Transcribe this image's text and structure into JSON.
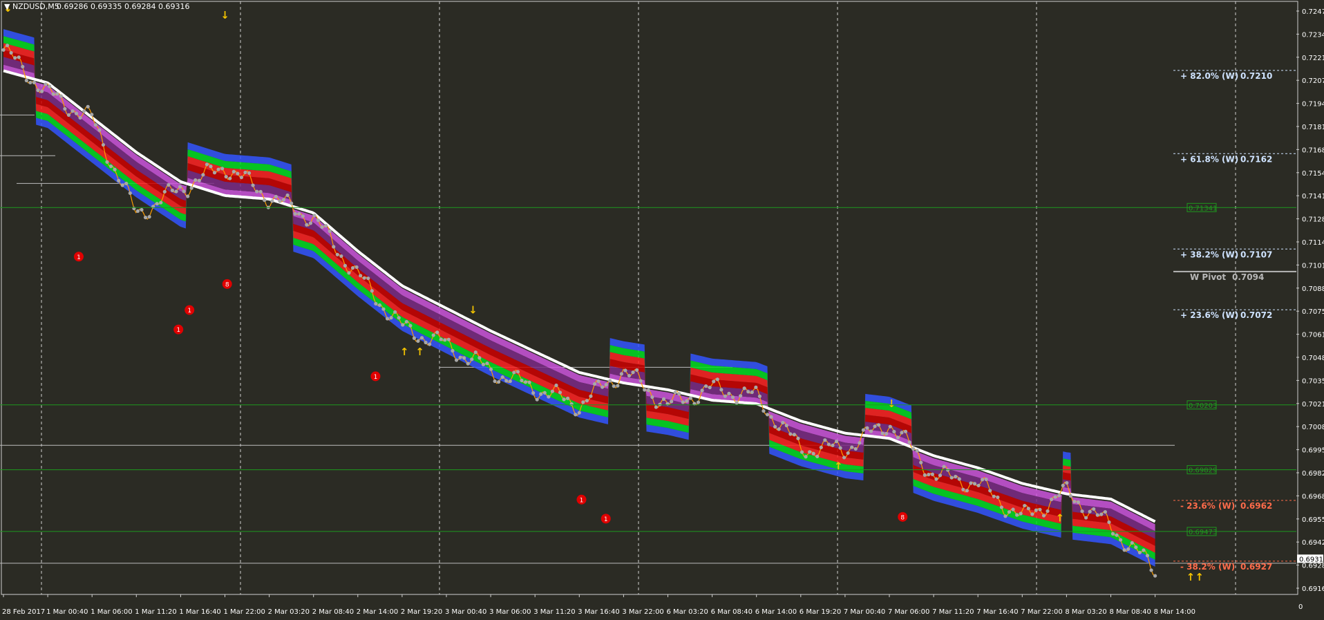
{
  "header": {
    "symbol": "NZDUSD,M5",
    "quote": "0.69286 0.69335 0.69284 0.69316",
    "menu_icon": "triangle-down-icon"
  },
  "colors": {
    "background": "#2b2b24",
    "grid": "#d0d0d0",
    "price_dots": "#a8a8a8",
    "fib_up": "#cfe3ff",
    "fib_down": "#ff6b4a",
    "pivot": "#b8b8b8",
    "green_levels": "#1e9a1e",
    "signal_dots": "#e00000",
    "arrows": "#f2c200"
  },
  "price_axis": {
    "labels": [
      "0.72475",
      "0.72345",
      "0.72210",
      "0.72075",
      "0.71945",
      "0.71810",
      "0.71680",
      "0.71545",
      "0.71410",
      "0.71280",
      "0.71145",
      "0.71015",
      "0.70880",
      "0.70750",
      "0.70615",
      "0.70480",
      "0.70350",
      "0.70215",
      "0.70085",
      "0.69950",
      "0.69820",
      "0.69685",
      "0.69550",
      "0.69420",
      "0.69285",
      "0.69160"
    ],
    "current_price": "0.69316"
  },
  "time_axis": {
    "labels": [
      "28 Feb 2017",
      "1 Mar 00:40",
      "1 Mar 06:00",
      "1 Mar 11:20",
      "1 Mar 16:40",
      "1 Mar 22:00",
      "2 Mar 03:20",
      "2 Mar 08:40",
      "2 Mar 14:00",
      "2 Mar 19:20",
      "3 Mar 00:40",
      "3 Mar 06:00",
      "3 Mar 11:20",
      "3 Mar 16:40",
      "3 Mar 22:00",
      "6 Mar 03:20",
      "6 Mar 08:40",
      "6 Mar 14:00",
      "6 Mar 19:20",
      "7 Mar 00:40",
      "7 Mar 06:00",
      "7 Mar 11:20",
      "7 Mar 16:40",
      "7 Mar 22:00",
      "8 Mar 03:20",
      "8 Mar 08:40",
      "8 Mar 14:00"
    ]
  },
  "fib_levels": [
    {
      "label": "+ 82.0% (W)",
      "value": "0.7210",
      "price": 0.721,
      "dir": "up"
    },
    {
      "label": "+ 61.8% (W)",
      "value": "0.7162",
      "price": 0.7162,
      "dir": "up"
    },
    {
      "label": "+ 38.2% (W)",
      "value": "0.7107",
      "price": 0.7107,
      "dir": "up"
    },
    {
      "label": "+ 23.6% (W)",
      "value": "0.7072",
      "price": 0.7072,
      "dir": "up"
    },
    {
      "label": "- 23.6% (W)",
      "value": "0.6962",
      "price": 0.6962,
      "dir": "down"
    },
    {
      "label": "- 38.2% (W)",
      "value": "0.6927",
      "price": 0.6927,
      "dir": "down"
    }
  ],
  "pivot": {
    "label": "W Pivot",
    "value": "0.7094",
    "price": 0.7094
  },
  "green_levels": [
    {
      "label": "0.71341",
      "price": 0.71341
    },
    {
      "label": "0.70203",
      "price": 0.70203
    },
    {
      "label": "0.69829",
      "price": 0.69829
    },
    {
      "label": "0.69473",
      "price": 0.69473
    }
  ],
  "chart_data": {
    "type": "line",
    "title": "NZDUSD,M5",
    "subtitle": "0.69286 0.69335 0.69284 0.69316",
    "xlabel": "",
    "ylabel": "",
    "ylim": [
      0.6911,
      0.7253
    ],
    "x": [
      "28 Feb 2017",
      "1 Mar 00:40",
      "1 Mar 06:00",
      "1 Mar 11:20",
      "1 Mar 16:40",
      "1 Mar 22:00",
      "2 Mar 03:20",
      "2 Mar 08:40",
      "2 Mar 14:00",
      "2 Mar 19:20",
      "3 Mar 00:40",
      "3 Mar 06:00",
      "3 Mar 11:20",
      "3 Mar 16:40",
      "3 Mar 22:00",
      "6 Mar 03:20",
      "6 Mar 08:40",
      "6 Mar 14:00",
      "6 Mar 19:20",
      "7 Mar 00:40",
      "7 Mar 06:00",
      "7 Mar 11:20",
      "7 Mar 16:40",
      "7 Mar 22:00",
      "8 Mar 03:20",
      "8 Mar 08:40",
      "8 Mar 14:00"
    ],
    "series": [
      {
        "values": [
          0.7225,
          0.72,
          0.7185,
          0.713,
          0.7145,
          0.7158,
          0.714,
          0.7128,
          0.7095,
          0.7065,
          0.7055,
          0.704,
          0.703,
          0.702,
          0.704,
          0.702,
          0.703,
          0.7025,
          0.6995,
          0.6995,
          0.701,
          0.698,
          0.6975,
          0.6955,
          0.697,
          0.695,
          0.6925
        ]
      },
      {
        "values": [
          0.7212,
          0.7205,
          0.7185,
          0.7165,
          0.7148,
          0.714,
          0.7138,
          0.713,
          0.7108,
          0.7088,
          0.7075,
          0.7062,
          0.705,
          0.7038,
          0.7032,
          0.7028,
          0.7022,
          0.702,
          0.701,
          0.7003,
          0.7,
          0.699,
          0.6983,
          0.6974,
          0.6968,
          0.6965,
          0.6952
        ]
      }
    ],
    "grid": true,
    "legend": "none"
  },
  "signals": {
    "red_dots": [
      {
        "time_index": 1.7,
        "price": 0.71058
      },
      {
        "time_index": 3.95,
        "price": 0.70638
      },
      {
        "time_index": 4.2,
        "price": 0.7075
      },
      {
        "time_index": 5.05,
        "price": 0.709
      },
      {
        "time_index": 8.4,
        "price": 0.70368
      },
      {
        "time_index": 13.05,
        "price": 0.69657
      },
      {
        "time_index": 13.6,
        "price": 0.69547
      },
      {
        "time_index": 20.3,
        "price": 0.69557
      }
    ],
    "labels": [
      "1",
      "1",
      "1",
      "8",
      "1",
      "1",
      "1",
      "8"
    ]
  }
}
